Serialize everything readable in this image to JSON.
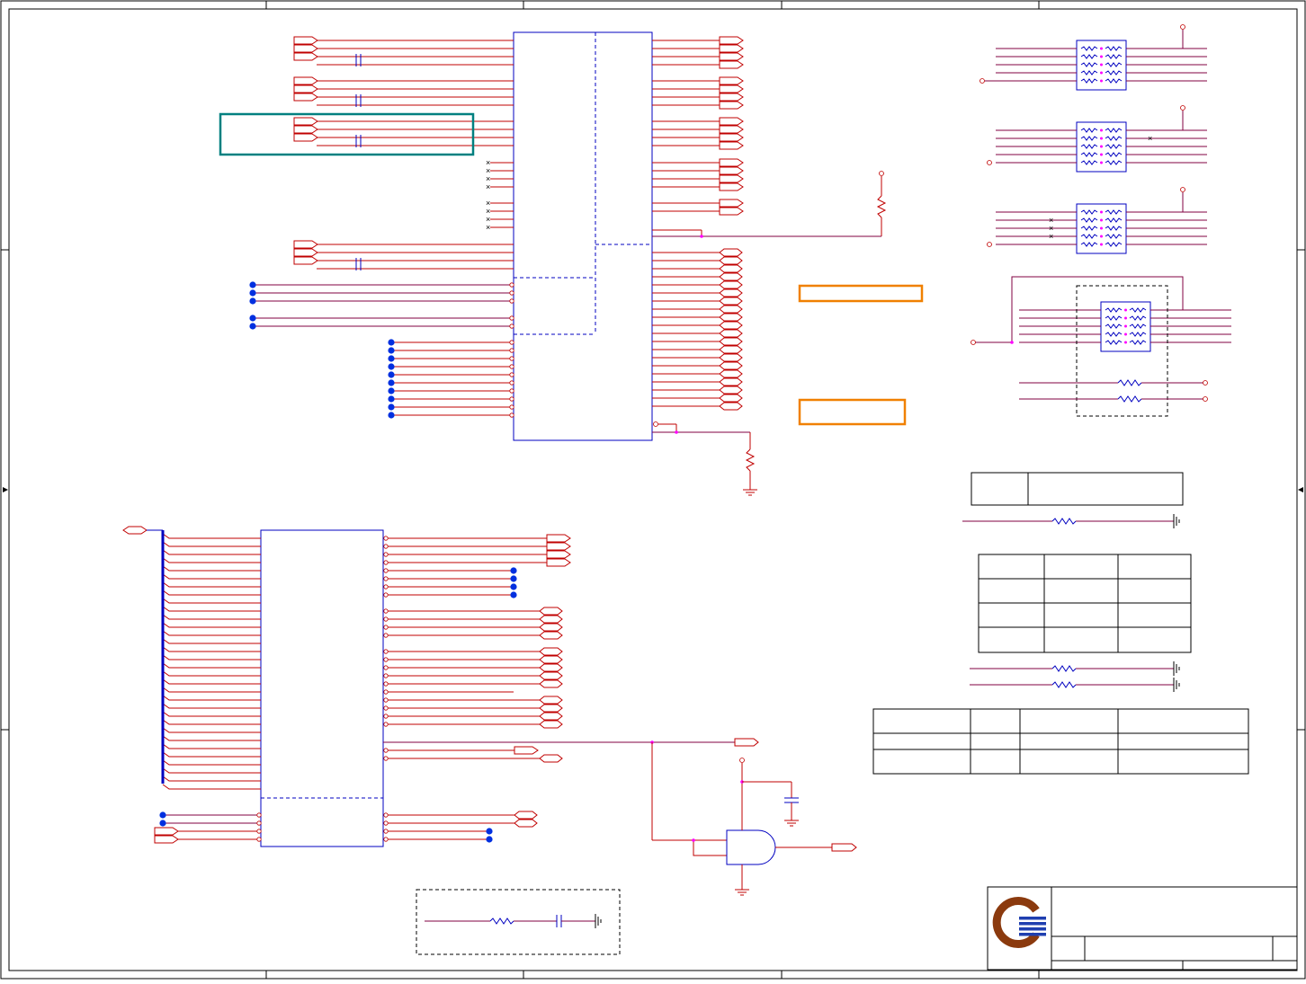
{
  "sheet": {
    "frame_color": "#000000",
    "wire_color": "#c00000",
    "component_color": "#0000c0",
    "net_color": "#800040",
    "highlight_box_colors": [
      "#008080",
      "#f08000"
    ]
  },
  "title_block": {
    "logo_icon": "company-logo-icon",
    "logo_colors": [
      "#8b3a0e",
      "#1f3fb0"
    ]
  },
  "table_small": {
    "rows": 1,
    "cols": 2
  },
  "table_mid": {
    "rows": 4,
    "cols": 3
  },
  "table_bottom": {
    "rows": 3,
    "cols": 4
  }
}
